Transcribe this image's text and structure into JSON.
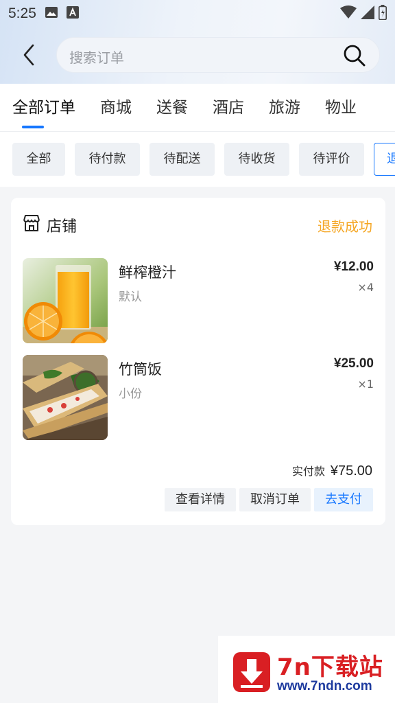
{
  "status_bar": {
    "time": "5:25"
  },
  "search": {
    "placeholder": "搜索订单"
  },
  "tabs": [
    {
      "label": "全部订单"
    },
    {
      "label": "商城"
    },
    {
      "label": "送餐"
    },
    {
      "label": "酒店"
    },
    {
      "label": "旅游"
    },
    {
      "label": "物业"
    }
  ],
  "filters": [
    {
      "label": "全部"
    },
    {
      "label": "待付款"
    },
    {
      "label": "待配送"
    },
    {
      "label": "待收货"
    },
    {
      "label": "待评价"
    },
    {
      "label": "退"
    }
  ],
  "order": {
    "shop_name": "店铺",
    "status": "退款成功",
    "items": [
      {
        "name": "鲜榨橙汁",
        "spec": "默认",
        "price": "¥12.00",
        "qty": "×4"
      },
      {
        "name": "竹筒饭",
        "spec": "小份",
        "price": "¥25.00",
        "qty": "×1"
      }
    ],
    "paid_label": "实付款",
    "paid_amount": "¥75.00",
    "actions": {
      "details": "查看详情",
      "cancel": "取消订单",
      "pay": "去支付"
    }
  },
  "watermark": {
    "title": "7n下载站",
    "url": "www.7ndn.com"
  },
  "colors": {
    "accent": "#1677ff",
    "status": "#f5a623",
    "background": "#f4f5f7"
  }
}
